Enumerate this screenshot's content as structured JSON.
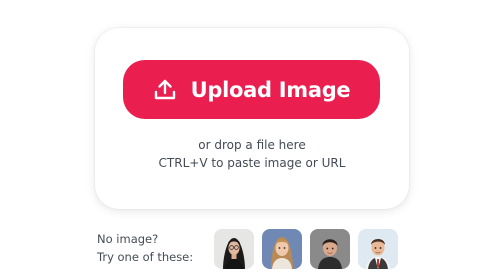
{
  "upload": {
    "button_label": "Upload Image",
    "icon": "upload-icon",
    "drop_hint": "or drop a file here",
    "paste_hint": "CTRL+V to paste image or URL"
  },
  "samples": {
    "line1": "No image?",
    "line2": "Try one of these:",
    "images": [
      {
        "icon": "woman-with-glasses-photo"
      },
      {
        "icon": "girl-portrait-photo"
      },
      {
        "icon": "boy-portrait-photo"
      },
      {
        "icon": "boy-in-vest-photo"
      }
    ]
  },
  "colors": {
    "accent": "#ea1e4f",
    "text": "#444b55",
    "card_bg": "#ffffff"
  }
}
